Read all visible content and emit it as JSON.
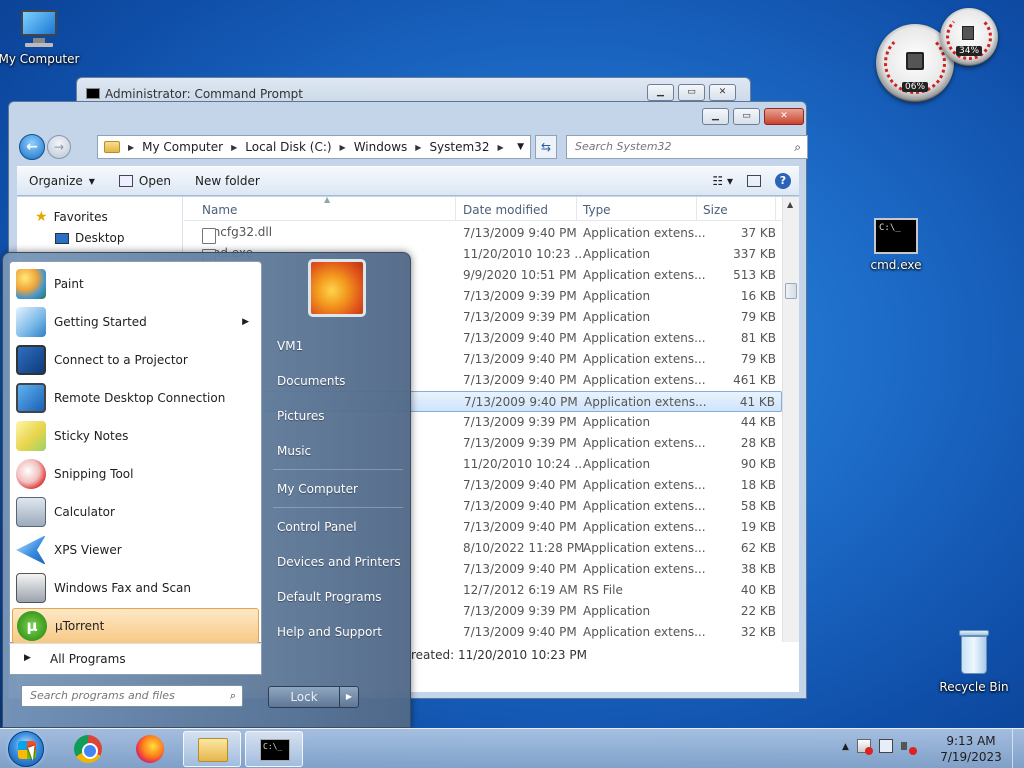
{
  "desktop": {
    "icons": [
      {
        "label": "My Computer"
      },
      {
        "label": "cmd.exe"
      },
      {
        "label": "Recycle Bin"
      }
    ]
  },
  "gadget": {
    "cpu": "06%",
    "mem": "34%"
  },
  "cmd_window": {
    "title": "Administrator:  Command Prompt"
  },
  "explorer": {
    "breadcrumb": [
      "My Computer",
      "Local Disk (C:)",
      "Windows",
      "System32"
    ],
    "search_placeholder": "Search System32",
    "toolbar": {
      "organize": "Organize",
      "open": "Open",
      "new_folder": "New folder"
    },
    "nav": {
      "favorites": "Favorites",
      "desktop": "Desktop"
    },
    "columns": {
      "name": "Name",
      "date": "Date modified",
      "type": "Type",
      "size": "Size"
    },
    "rows": [
      {
        "name": "cmcfg32.dll",
        "date": "7/13/2009 9:40 PM",
        "type": "Application extens...",
        "size": "37 KB"
      },
      {
        "name": "cmd.exe",
        "date": "11/20/2010 10:23 ...",
        "type": "Application",
        "size": "337 KB"
      },
      {
        "name": "",
        "date": "9/9/2020 10:51 PM",
        "type": "Application extens...",
        "size": "513 KB"
      },
      {
        "name": "",
        "date": "7/13/2009 9:39 PM",
        "type": "Application",
        "size": "16 KB"
      },
      {
        "name": "",
        "date": "7/13/2009 9:39 PM",
        "type": "Application",
        "size": "79 KB"
      },
      {
        "name": "",
        "date": "7/13/2009 9:40 PM",
        "type": "Application extens...",
        "size": "81 KB"
      },
      {
        "name": "",
        "date": "7/13/2009 9:40 PM",
        "type": "Application extens...",
        "size": "79 KB"
      },
      {
        "name": "",
        "date": "7/13/2009 9:40 PM",
        "type": "Application extens...",
        "size": "461 KB"
      },
      {
        "name": "",
        "date": "7/13/2009 9:40 PM",
        "type": "Application extens...",
        "size": "41 KB"
      },
      {
        "name": "",
        "date": "7/13/2009 9:39 PM",
        "type": "Application",
        "size": "44 KB"
      },
      {
        "name": "",
        "date": "7/13/2009 9:39 PM",
        "type": "Application extens...",
        "size": "28 KB"
      },
      {
        "name": "",
        "date": "11/20/2010 10:24 ...",
        "type": "Application",
        "size": "90 KB"
      },
      {
        "name": "",
        "date": "7/13/2009 9:40 PM",
        "type": "Application extens...",
        "size": "18 KB"
      },
      {
        "name": "",
        "date": "7/13/2009 9:40 PM",
        "type": "Application extens...",
        "size": "58 KB"
      },
      {
        "name": "",
        "date": "7/13/2009 9:40 PM",
        "type": "Application extens...",
        "size": "19 KB"
      },
      {
        "name": "",
        "date": "8/10/2022 11:28 PM",
        "type": "Application extens...",
        "size": "62 KB"
      },
      {
        "name": "",
        "date": "7/13/2009 9:40 PM",
        "type": "Application extens...",
        "size": "38 KB"
      },
      {
        "name": "",
        "date": "12/7/2012 6:19 AM",
        "type": "RS File",
        "size": "40 KB"
      },
      {
        "name": "",
        "date": "7/13/2009 9:39 PM",
        "type": "Application",
        "size": "22 KB"
      },
      {
        "name": "",
        "date": "7/13/2009 9:40 PM",
        "type": "Application extens...",
        "size": "32 KB"
      }
    ],
    "details_text": "reated:  11/20/2010 10:23 PM"
  },
  "start_menu": {
    "programs": [
      {
        "label": "Paint"
      },
      {
        "label": "Getting Started"
      },
      {
        "label": "Connect to a Projector"
      },
      {
        "label": "Remote Desktop Connection"
      },
      {
        "label": "Sticky Notes"
      },
      {
        "label": "Snipping Tool"
      },
      {
        "label": "Calculator"
      },
      {
        "label": "XPS Viewer"
      },
      {
        "label": "Windows Fax and Scan"
      },
      {
        "label": "µTorrent"
      }
    ],
    "all_programs": "All Programs",
    "search_placeholder": "Search programs and files",
    "right": [
      "VM1",
      "Documents",
      "Pictures",
      "Music",
      "My Computer",
      "Control Panel",
      "Devices and Printers",
      "Default Programs",
      "Help and Support"
    ],
    "lock": "Lock"
  },
  "taskbar": {
    "time": "9:13 AM",
    "date": "7/19/2023"
  },
  "colors": {
    "accent": "#1d6cc8",
    "highlight": "#f8c986",
    "selection": "#cfe4fb"
  }
}
